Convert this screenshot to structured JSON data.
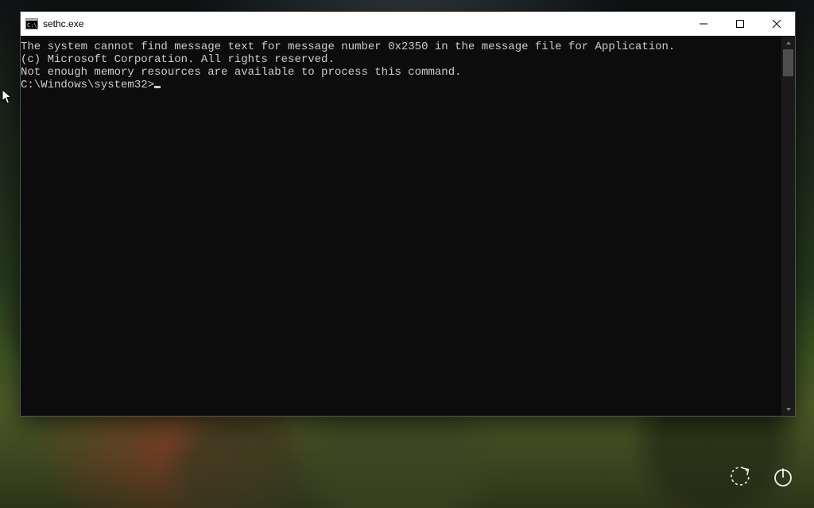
{
  "window": {
    "title": "sethc.exe"
  },
  "console": {
    "line1": "The system cannot find message text for message number 0x2350 in the message file for Application.",
    "blank1": "",
    "line2": "(c) Microsoft Corporation. All rights reserved.",
    "line3": "Not enough memory resources are available to process this command.",
    "blank2": "",
    "prompt": "C:\\Windows\\system32>"
  }
}
